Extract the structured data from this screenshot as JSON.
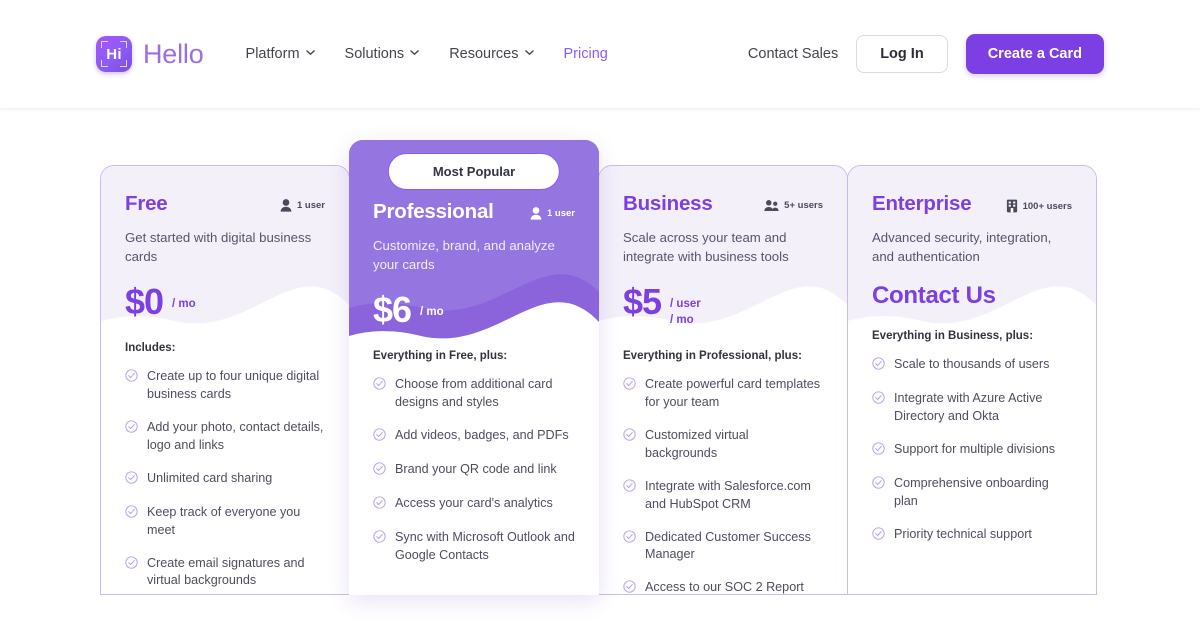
{
  "header": {
    "logo_text": "Hello",
    "logo_mark_text": "Hi",
    "nav": [
      {
        "label": "Platform",
        "has_caret": true,
        "accent": false
      },
      {
        "label": "Solutions",
        "has_caret": true,
        "accent": false
      },
      {
        "label": "Resources",
        "has_caret": true,
        "accent": false
      },
      {
        "label": "Pricing",
        "has_caret": false,
        "accent": true
      }
    ],
    "contact_sales": "Contact Sales",
    "login": "Log In",
    "create_card": "Create a Card"
  },
  "badge": {
    "label": "Most Popular"
  },
  "colors": {
    "brand_purple": "#7b3fe4",
    "featured_purple": "#9575e0",
    "featured_purple_dark": "#8b63db",
    "card_tint": "#f4f0fa",
    "card_border": "#cdb9ef",
    "accent_text": "#7c3fe0"
  },
  "plans": [
    {
      "name": "Free",
      "users_label": "1 user",
      "users_icon": "single-user-icon",
      "tagline": "Get started with digital business cards",
      "price": "$0",
      "per_lines": [
        "/ mo"
      ],
      "features_heading": "Includes:",
      "features": [
        "Create up to four unique digital business cards",
        "Add your photo, contact details, logo and links",
        "Unlimited card sharing",
        "Keep track of everyone you meet",
        "Create email signatures and virtual backgrounds"
      ]
    },
    {
      "name": "Professional",
      "users_label": "1 user",
      "users_icon": "single-user-icon",
      "tagline": "Customize, brand, and analyze your cards",
      "price": "$6",
      "per_lines": [
        "/ mo"
      ],
      "features_heading": "Everything in Free, plus:",
      "features": [
        "Choose from additional card designs and styles",
        "Add videos, badges, and PDFs",
        "Brand your QR code and link",
        "Access your card's analytics",
        "Sync with Microsoft Outlook and Google Contacts"
      ]
    },
    {
      "name": "Business",
      "users_label": "5+ users",
      "users_icon": "multi-user-icon",
      "tagline": "Scale across your team and integrate with business tools",
      "price": "$5",
      "per_lines": [
        "/ user",
        "/ mo"
      ],
      "features_heading": "Everything in Professional, plus:",
      "features": [
        "Create powerful card templates for your team",
        "Customized virtual backgrounds",
        "Integrate with Salesforce.com and HubSpot CRM",
        "Dedicated Customer Success Manager",
        "Access to our SOC 2 Report"
      ]
    },
    {
      "name": "Enterprise",
      "users_label": "100+ users",
      "users_icon": "building-icon",
      "tagline": "Advanced security, integration, and authentication",
      "price": "Contact Us",
      "per_lines": [],
      "features_heading": "Everything in Business, plus:",
      "features": [
        "Scale to thousands of users",
        "Integrate with Azure Active Directory and Okta",
        "Support for multiple divisions",
        "Comprehensive onboarding plan",
        "Priority technical support"
      ]
    }
  ]
}
